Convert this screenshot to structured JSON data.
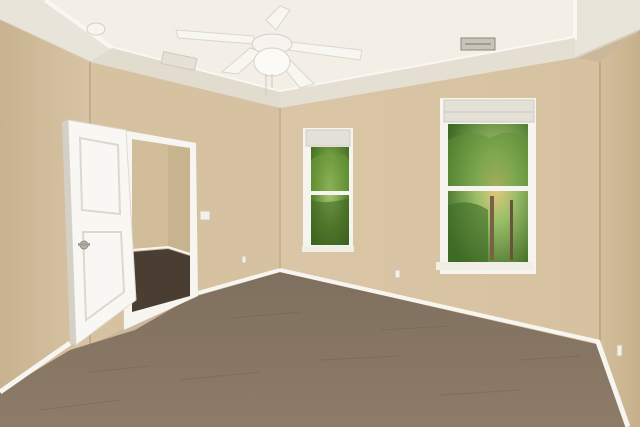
{
  "scene": {
    "room": "empty-bedroom",
    "ceiling_fan": true,
    "windows": 2,
    "open_door": true
  },
  "colors": {
    "wall_light": "#dcc9ab",
    "wall_shade": "#c9b592",
    "ceiling": "#eee9e0",
    "tray_ceiling": "#f4f1ea",
    "trim": "#f7f5ef",
    "carpet": "#8b7966",
    "carpet_dark": "#6f604f",
    "foliage": "#4f7a2c",
    "foliage_light": "#9cc06a"
  }
}
